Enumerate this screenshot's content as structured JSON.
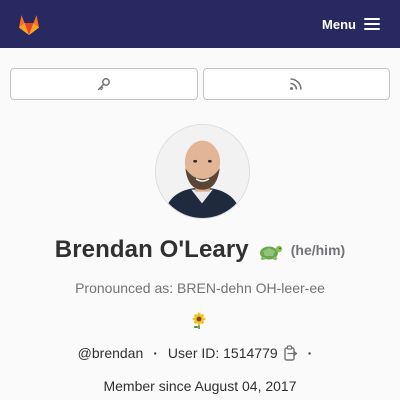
{
  "header": {
    "logo_icon": "gitlab-tanuki-icon",
    "menu_label": "Menu",
    "menu_icon": "hamburger-icon",
    "background_color": "#292961"
  },
  "actions": {
    "buttons": [
      {
        "icon": "key-icon"
      },
      {
        "icon": "rss-icon"
      }
    ]
  },
  "profile": {
    "name": "Brendan O'Leary",
    "status_emoji": "turtle-icon",
    "pronouns": "(he/him)",
    "pronunciation": "Pronounced as: BREN-dehn OH-leer-ee",
    "bio_emoji": "sunflower-icon",
    "username": "@brendan",
    "user_id": "User ID: 1514779",
    "member_since": "Member since August 04, 2017",
    "separator": "·"
  }
}
